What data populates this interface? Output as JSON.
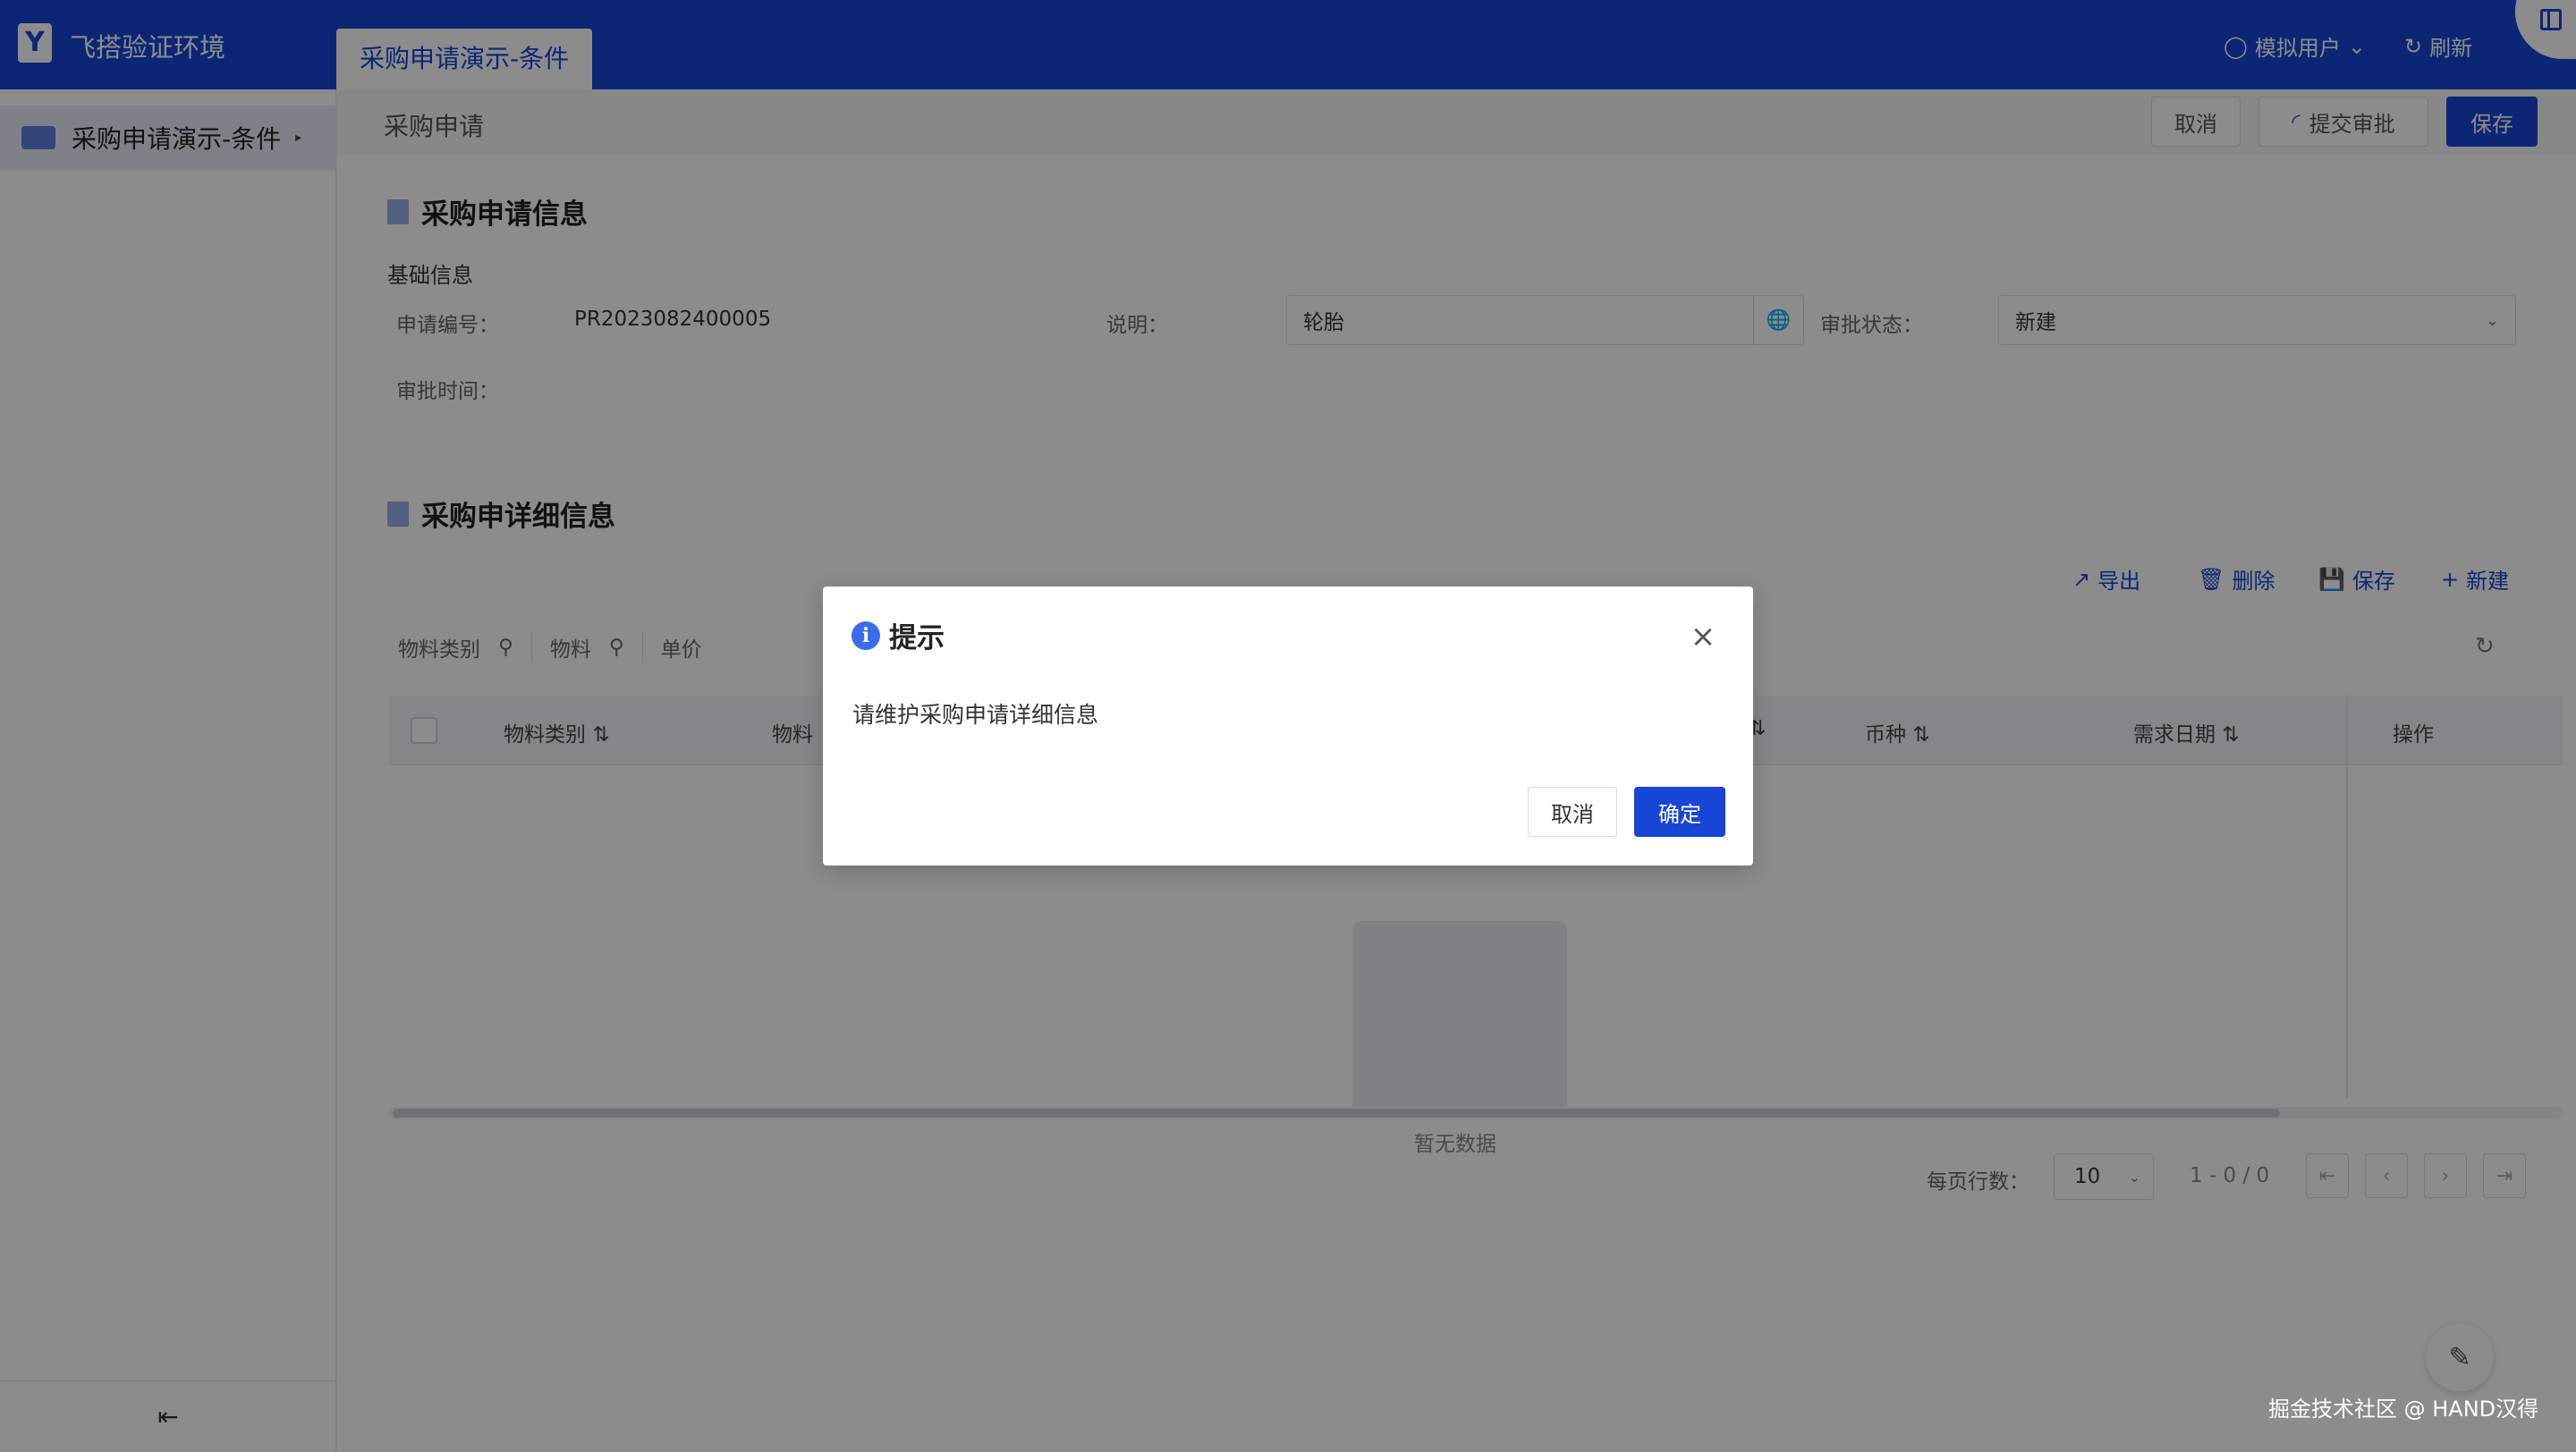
{
  "app": {
    "title": "飞搭验证环境",
    "active_tab": "采购申请演示-条件"
  },
  "topbar": {
    "user_label": "模拟用户",
    "refresh_label": "刷新"
  },
  "sidebar": {
    "items": [
      {
        "label": "采购申请演示-条件"
      }
    ]
  },
  "header": {
    "breadcrumb": "采购申请",
    "cancel_label": "取消",
    "submit_label": "提交审批",
    "save_label": "保存"
  },
  "form": {
    "section_title": "采购申请信息",
    "subsection": "基础信息",
    "fields": {
      "number_label": "申请编号：",
      "number_value": "PR2023082400005",
      "desc_label": "说明：",
      "desc_value": "轮胎",
      "status_label": "审批状态：",
      "status_value": "新建",
      "approval_time_label": "审批时间："
    }
  },
  "detail": {
    "section_title": "采购申详细信息",
    "toolbar": {
      "export": "导出",
      "delete": "删除",
      "save": "保存",
      "new": "新建"
    },
    "filters": [
      "物料类别",
      "物料",
      "单价"
    ],
    "columns": [
      "物料类别",
      "物料",
      "币种",
      "需求日期",
      "操作"
    ],
    "empty_text": "暂无数据",
    "pager": {
      "rows_label": "每页行数：",
      "page_size": "10",
      "range": "1 - 0 / 0"
    }
  },
  "watermark": "掘金技术社区 @ HAND汉得",
  "modal": {
    "title": "提示",
    "message": "请维护采购申请详细信息",
    "cancel_label": "取消",
    "ok_label": "确定"
  },
  "colors": {
    "primary": "#1745d6",
    "mask": "rgba(0,0,0,0.45)"
  }
}
